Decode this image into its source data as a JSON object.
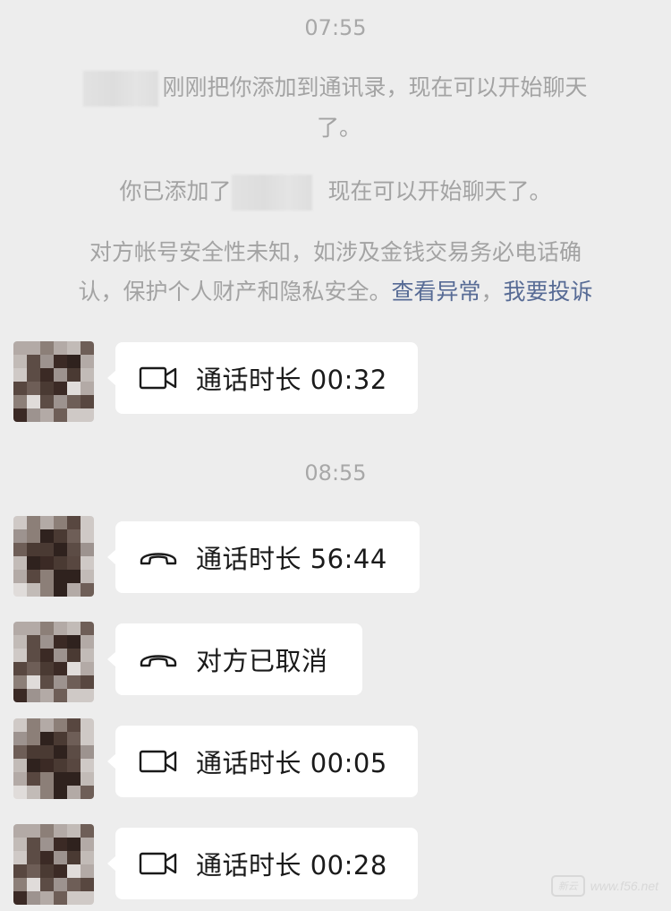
{
  "timestamps": [
    "07:55",
    "08:55"
  ],
  "system": {
    "added_you_line1": "刚刚把你添加到通讯录，现在可以开始聊天",
    "added_you_line2": "了。",
    "you_added_prefix": "你已添加了",
    "you_added_suffix": "现在可以开始聊天了。",
    "security_line1": "对方帐号安全性未知，如涉及金钱交易务必电话确",
    "security_line2": "认，保护个人财产和隐私安全。",
    "view_abnormal": "查看异常",
    "comma": "，",
    "report": "我要投诉"
  },
  "messages": [
    {
      "icon": "video-camera-icon",
      "text": "通话时长 00:32"
    },
    {
      "icon": "phone-handset-icon",
      "text": "通话时长 56:44"
    },
    {
      "icon": "phone-handset-icon",
      "text": "对方已取消"
    },
    {
      "icon": "video-camera-icon",
      "text": "通话时长 00:05"
    },
    {
      "icon": "video-camera-icon",
      "text": "通话时长 00:28"
    }
  ],
  "colors": {
    "background": "#ededed",
    "bubble": "#ffffff",
    "link": "#576b95",
    "system_text": "#a3a3a3"
  },
  "watermark": {
    "badge": "新云",
    "text": "www.f56.net"
  }
}
